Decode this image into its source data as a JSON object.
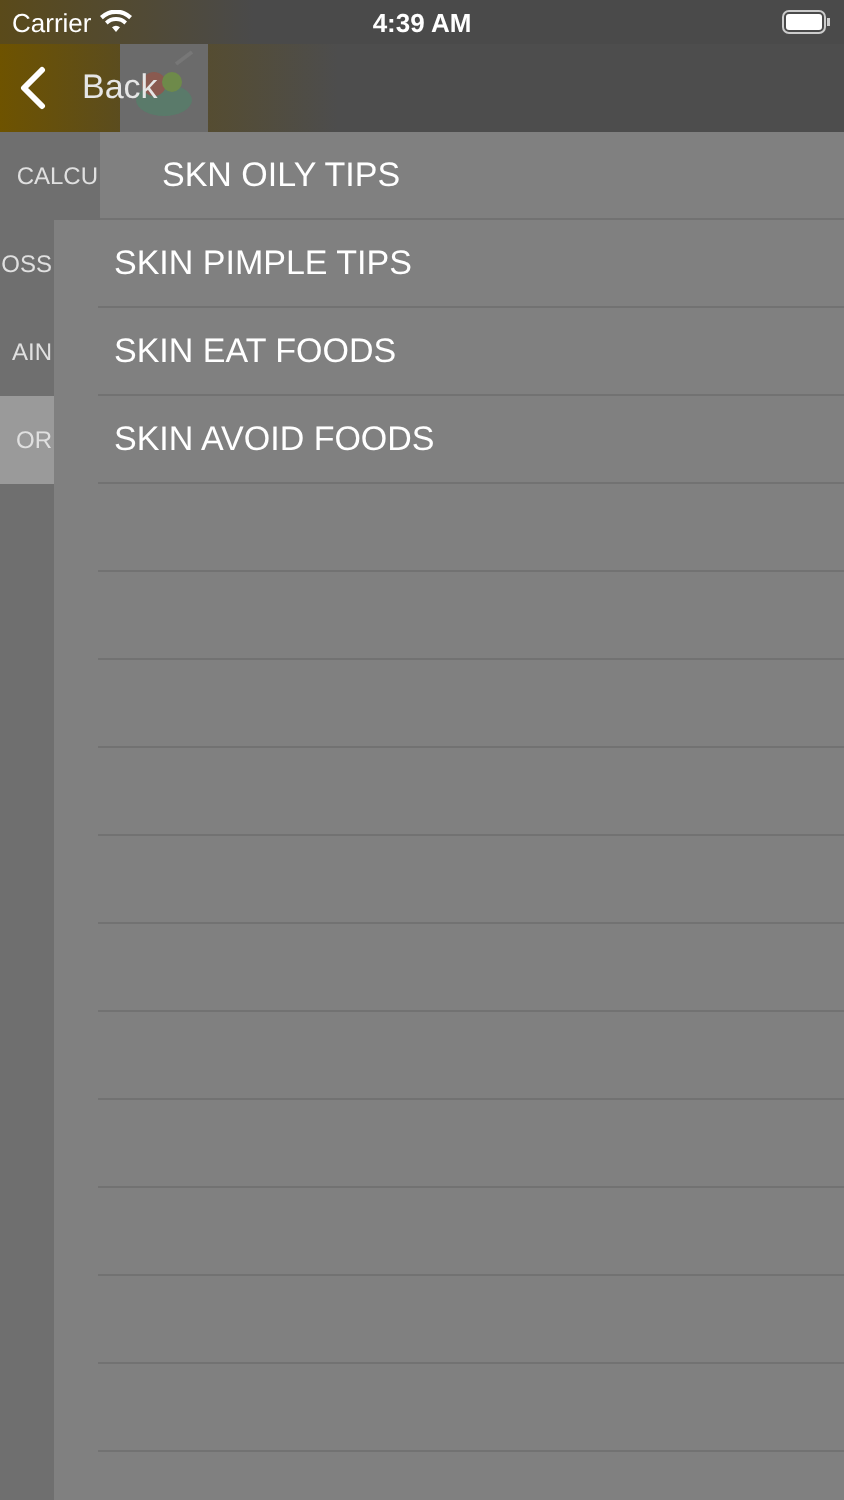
{
  "status_bar": {
    "carrier": "Carrier",
    "time": "4:39 AM"
  },
  "nav": {
    "back_label": "Back"
  },
  "background_list": [
    {
      "label": "CALCU",
      "selected": false
    },
    {
      "label": "OSS",
      "selected": false
    },
    {
      "label": "AIN",
      "selected": false
    },
    {
      "label": "OR",
      "selected": true
    }
  ],
  "list": [
    {
      "label": "SKN OILY TIPS"
    },
    {
      "label": "SKIN PIMPLE TIPS"
    },
    {
      "label": "SKIN EAT FOODS"
    },
    {
      "label": "SKIN AVOID FOODS"
    }
  ]
}
